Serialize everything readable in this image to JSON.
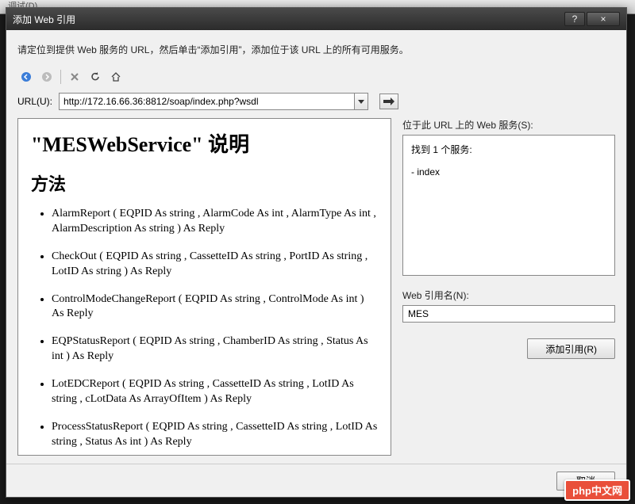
{
  "bgmenu": "调试(D)",
  "titlebar": {
    "title": "添加 Web 引用",
    "help": "?",
    "close": "×"
  },
  "instruction": "请定位到提供 Web 服务的 URL，然后单击“添加引用”，添加位于该 URL 上的所有可用服务。",
  "url": {
    "label": "URL(U):",
    "value": "http://172.16.66.36:8812/soap/index.php?wsdl"
  },
  "icons": {
    "back": "back-icon",
    "forward": "forward-icon",
    "stop": "stop-icon",
    "refresh": "refresh-icon",
    "home": "home-icon",
    "dropdown": "chevron-down-icon",
    "go": "go-icon"
  },
  "doc": {
    "heading": "\"MESWebService\" 说明",
    "subheading": "方法",
    "methods": [
      "AlarmReport ( EQPID As string ,  AlarmCode As int ,  AlarmType As int ,  AlarmDescription As string ) As Reply",
      "CheckOut ( EQPID As string ,  CassetteID As string ,  PortID As string ,  LotID As string ) As Reply",
      "ControlModeChangeReport ( EQPID As string ,  ControlMode As int ) As Reply",
      "EQPStatusReport ( EQPID As string ,  ChamberID As string ,  Status As int ) As Reply",
      "LotEDCReport ( EQPID As string ,  CassetteID As string ,  LotID As string ,  cLotData As ArrayOfItem ) As Reply",
      "ProcessStatusReport ( EQPID As string ,  CassetteID As string ,  LotID As string ,  Status As int ) As Reply"
    ]
  },
  "right": {
    "services_label": "位于此 URL 上的 Web 服务(S):",
    "found": "找到 1 个服务:",
    "service_item": "- index",
    "refname_label": "Web 引用名(N):",
    "refname_value": "MES",
    "add_button": "添加引用(R)"
  },
  "footer": {
    "cancel": "取消"
  },
  "watermark": "php中文网"
}
